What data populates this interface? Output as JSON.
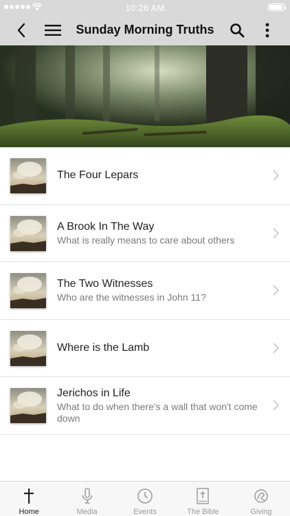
{
  "status_bar": {
    "time": "10:26 AM"
  },
  "nav": {
    "title": "Sunday Morning Truths"
  },
  "icons": {
    "back": "back-chevron-icon",
    "menu": "hamburger-menu-icon",
    "search": "search-icon",
    "more": "more-vertical-icon"
  },
  "list": {
    "items": [
      {
        "title": "The Four Lepars",
        "subtitle": ""
      },
      {
        "title": "A Brook In The Way",
        "subtitle": "What is really means to care about others"
      },
      {
        "title": "The Two Witnesses",
        "subtitle": "Who are the witnesses in John 11?"
      },
      {
        "title": "Where is the Lamb",
        "subtitle": ""
      },
      {
        "title": "Jerichos in Life",
        "subtitle": "What to do when there's a wall that won't come down"
      }
    ]
  },
  "tabs": [
    {
      "label": "Home",
      "icon": "cross-icon",
      "active": true
    },
    {
      "label": "Media",
      "icon": "microphone-icon",
      "active": false
    },
    {
      "label": "Events",
      "icon": "clock-icon",
      "active": false
    },
    {
      "label": "The Bible",
      "icon": "bible-icon",
      "active": false
    },
    {
      "label": "Giving",
      "icon": "giving-icon",
      "active": false
    }
  ],
  "colors": {
    "bar_background": "#d9d9d9",
    "active_tab": "#222222",
    "inactive_tab": "#9a9a9a"
  }
}
